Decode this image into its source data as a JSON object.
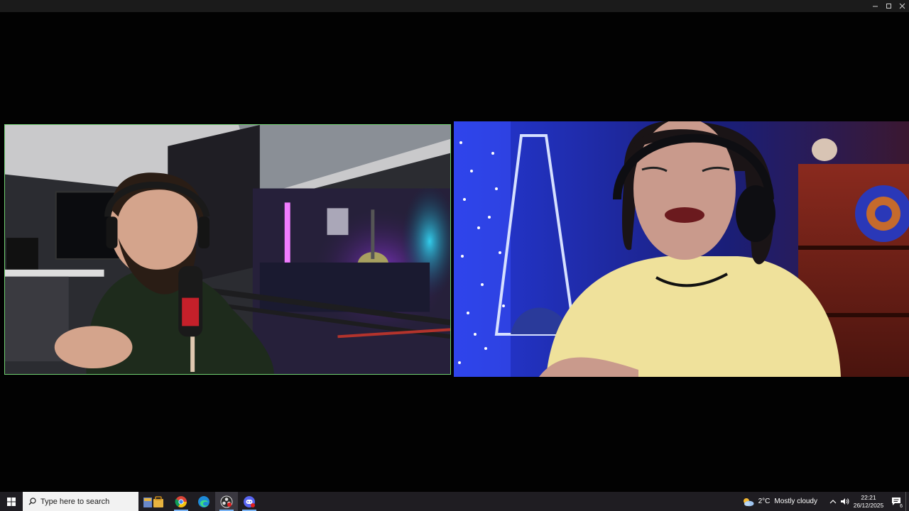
{
  "window": {
    "controls": [
      "minimize",
      "maximize",
      "close"
    ]
  },
  "videos": {
    "left": {
      "speaking": true,
      "highlight_color": "#6fcf6f"
    },
    "right": {
      "speaking": false
    }
  },
  "taskbar": {
    "search_placeholder": "Type here to search",
    "apps": [
      {
        "name": "news-icon"
      },
      {
        "name": "store-icon"
      },
      {
        "name": "chrome-icon"
      },
      {
        "name": "edge-icon"
      },
      {
        "name": "obs-icon"
      },
      {
        "name": "discord-icon"
      }
    ],
    "weather": {
      "temperature": "2°C",
      "condition": "Mostly cloudy"
    },
    "clock": {
      "time": "22:21",
      "date": "26/12/2025"
    },
    "notification_count": "6"
  },
  "colors": {
    "taskbar_bg": "#1f1d22",
    "speaker_border": "#6fcf6f"
  }
}
